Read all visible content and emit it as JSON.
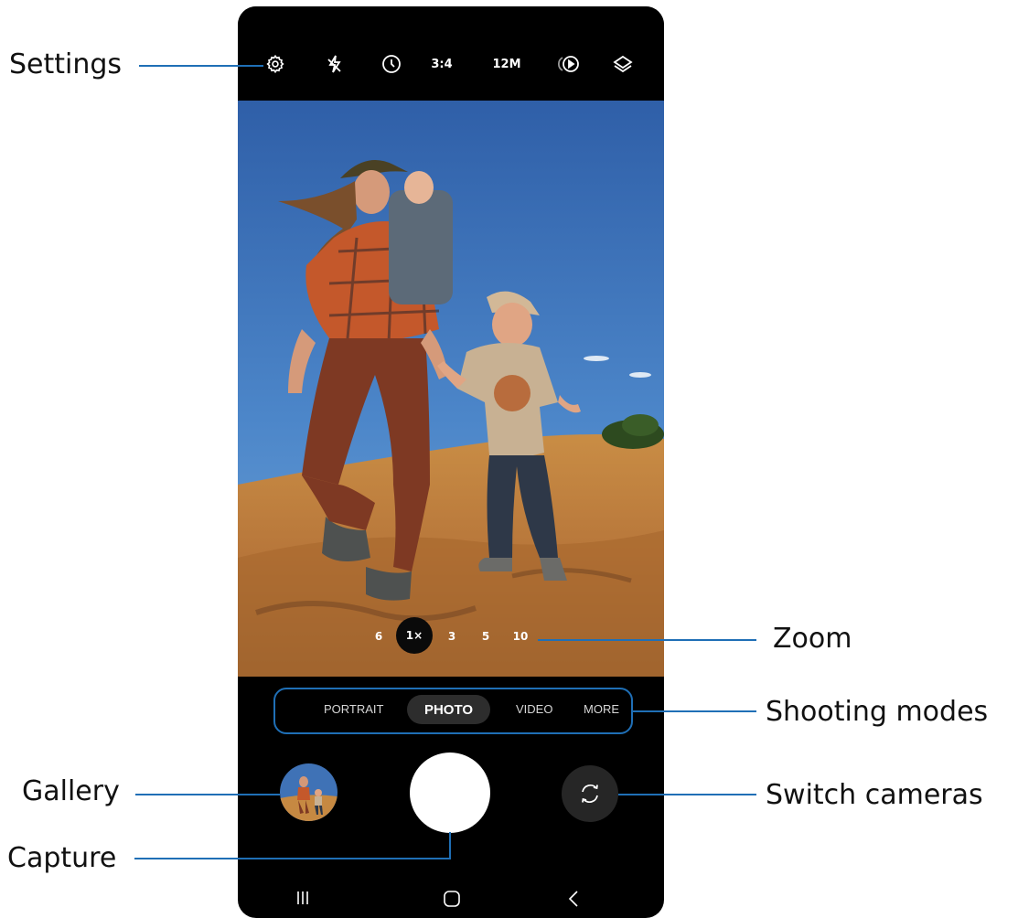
{
  "topbar": {
    "settings_icon": "gear-icon",
    "flash_icon": "flash-off-icon",
    "timer_icon": "timer-icon",
    "ratio": "3:4",
    "resolution": "12M",
    "motion_icon": "motion-photo-icon",
    "filters_icon": "layers-icon"
  },
  "zoom": {
    "options": [
      "6",
      "1×",
      "3",
      "5",
      "10"
    ],
    "active": "1×"
  },
  "modes": {
    "items": [
      "PORTRAIT",
      "PHOTO",
      "VIDEO",
      "MORE"
    ],
    "active": "PHOTO"
  },
  "controls": {
    "gallery_icon": "gallery-thumbnail",
    "shutter_icon": "capture-button",
    "switch_icon": "switch-camera-icon"
  },
  "navbar": {
    "recent_icon": "recent-apps-icon",
    "home_icon": "home-icon",
    "back_icon": "back-icon"
  },
  "callouts": {
    "settings": "Settings",
    "zoom": "Zoom",
    "shooting_modes": "Shooting modes",
    "gallery": "Gallery",
    "switch_cameras": "Switch cameras",
    "capture": "Capture"
  },
  "colors": {
    "callout_line": "#1f6fb6",
    "sky_top": "#3d6fb4",
    "ground": "#c8893d"
  }
}
